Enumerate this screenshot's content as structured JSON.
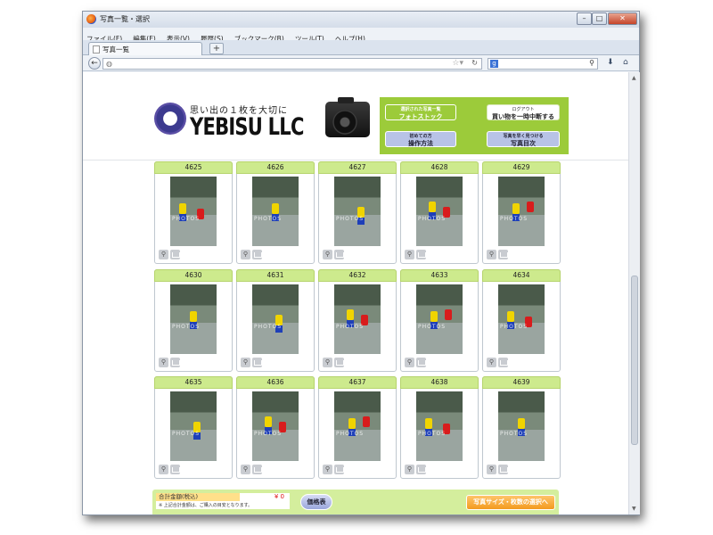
{
  "window": {
    "title": "写真一覧・選択",
    "controls": {
      "minimize": "–",
      "maximize": "□",
      "close": "✕"
    }
  },
  "menu": [
    "ファイル(F)",
    "編集(E)",
    "表示(V)",
    "履歴(S)",
    "ブックマーク(B)",
    "ツール(T)",
    "ヘルプ(H)"
  ],
  "tabs": [
    {
      "label": "写真一覧"
    }
  ],
  "new_tab_label": "+",
  "toolbar": {
    "url": "",
    "search_engine": "g",
    "search_value": ""
  },
  "header": {
    "tagline": "思い出の１枚を大切に",
    "brand": "YEBISU LLC",
    "buttons": {
      "photostock_small": "選択された写真一覧",
      "photostock": "フォトストック",
      "logout_small": "ログアウト",
      "logout": "買い物を一時中断する",
      "howto_small": "初めての方",
      "howto": "操作方法",
      "index_small": "写真を早く見つける",
      "index": "写真目次"
    }
  },
  "photos": [
    {
      "number": "4625"
    },
    {
      "number": "4626"
    },
    {
      "number": "4627"
    },
    {
      "number": "4628"
    },
    {
      "number": "4629"
    },
    {
      "number": "4630"
    },
    {
      "number": "4631"
    },
    {
      "number": "4632"
    },
    {
      "number": "4633"
    },
    {
      "number": "4634"
    },
    {
      "number": "4635"
    },
    {
      "number": "4636"
    },
    {
      "number": "4637"
    },
    {
      "number": "4638"
    },
    {
      "number": "4639"
    }
  ],
  "watermark": "PHOTOS",
  "footer": {
    "total_label": "合計金額(税込)",
    "total_value": "¥ 0",
    "note": "※ 上記合計金額は、ご購入の目安となります。",
    "price_button": "価格表",
    "next_button": "写真サイズ・枚数の選択へ"
  },
  "colors": {
    "green": "#9ccb3a",
    "number_bar": "#cdea8d",
    "orange": "#f39a1e",
    "lavender": "#b8c3e6"
  }
}
